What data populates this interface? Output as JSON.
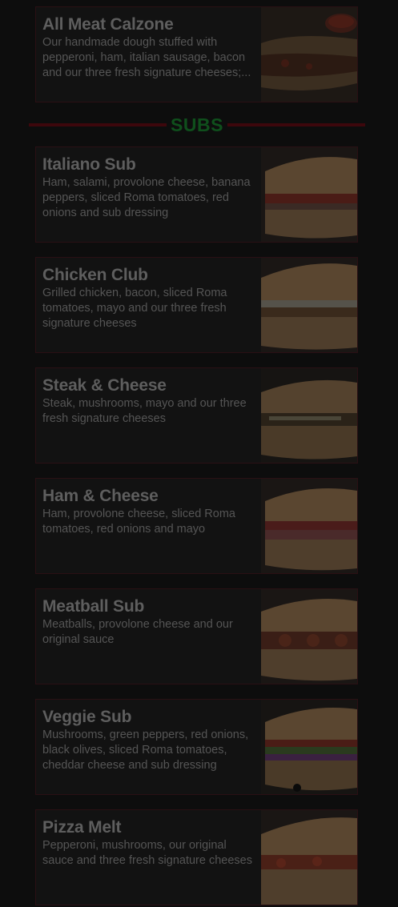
{
  "calzone": {
    "title": "All Meat Calzone",
    "description": "Our handmade dough stuffed with pepperoni, ham, italian sausage, bacon and our three fresh signature cheeses;..."
  },
  "section": {
    "label": "SUBS"
  },
  "subs": [
    {
      "title": "Italiano Sub",
      "description": "Ham, salami, provolone cheese, banana peppers, sliced Roma tomatoes, red onions and sub dressing"
    },
    {
      "title": "Chicken Club",
      "description": "Grilled chicken, bacon, sliced Roma tomatoes, mayo and our three fresh signature cheeses"
    },
    {
      "title": "Steak & Cheese",
      "description": "Steak, mushrooms, mayo and our three fresh signature cheeses"
    },
    {
      "title": "Ham & Cheese",
      "description": "Ham, provolone cheese, sliced Roma tomatoes, red onions and mayo"
    },
    {
      "title": "Meatball Sub",
      "description": "Meatballs, provolone cheese and our original sauce"
    },
    {
      "title": "Veggie Sub",
      "description": "Mushrooms, green peppers, red onions, black olives, sliced Roma tomatoes, cheddar cheese and sub dressing"
    },
    {
      "title": "Pizza Melt",
      "description": "Pepperoni, mushrooms, our original sauce and three fresh signature cheeses"
    }
  ],
  "colors": {
    "background": "#0d0d0d",
    "accent_red": "#3d070c",
    "accent_green": "#0f4f1c",
    "text": "#5e5e5e"
  }
}
